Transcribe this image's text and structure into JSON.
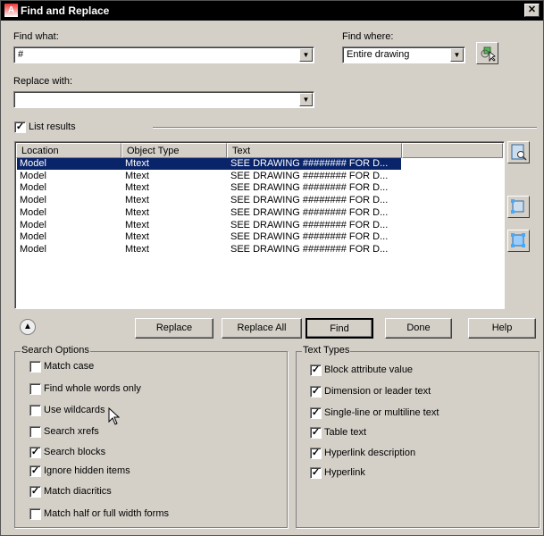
{
  "title": "Find and Replace",
  "find_what": {
    "label": "Find what:",
    "value": "#"
  },
  "find_where": {
    "label": "Find where:",
    "value": "Entire drawing"
  },
  "replace_with": {
    "label": "Replace with:",
    "value": ""
  },
  "list_results": {
    "label": "List results",
    "checked": true
  },
  "results": {
    "columns": [
      "Location",
      "Object Type",
      "Text"
    ],
    "rows": [
      [
        "Model",
        "Mtext",
        "SEE DRAWING ######## FOR D..."
      ],
      [
        "Model",
        "Mtext",
        "SEE DRAWING ######## FOR D..."
      ],
      [
        "Model",
        "Mtext",
        "SEE DRAWING ######## FOR D..."
      ],
      [
        "Model",
        "Mtext",
        "SEE DRAWING ######## FOR D..."
      ],
      [
        "Model",
        "Mtext",
        "SEE DRAWING ######## FOR D..."
      ],
      [
        "Model",
        "Mtext",
        "SEE DRAWING ######## FOR D..."
      ],
      [
        "Model",
        "Mtext",
        "SEE DRAWING ######## FOR D..."
      ],
      [
        "Model",
        "Mtext",
        "SEE DRAWING ######## FOR D..."
      ]
    ]
  },
  "buttons": {
    "replace": "Replace",
    "replace_all": "Replace All",
    "find": "Find",
    "done": "Done",
    "help": "Help"
  },
  "search_options": {
    "title": "Search Options",
    "items": [
      {
        "label": "Match case",
        "checked": false
      },
      {
        "label": "Find whole words only",
        "checked": false
      },
      {
        "label": "Use wildcards",
        "checked": false
      },
      {
        "label": "Search xrefs",
        "checked": false
      },
      {
        "label": "Search blocks",
        "checked": true
      },
      {
        "label": "Ignore hidden items",
        "checked": true
      },
      {
        "label": "Match diacritics",
        "checked": true
      },
      {
        "label": "Match half or full width forms",
        "checked": false
      }
    ]
  },
  "text_types": {
    "title": "Text Types",
    "items": [
      {
        "label": "Block attribute value",
        "checked": true
      },
      {
        "label": "Dimension or leader text",
        "checked": true
      },
      {
        "label": "Single-line or multiline text",
        "checked": true
      },
      {
        "label": "Table text",
        "checked": true
      },
      {
        "label": "Hyperlink description",
        "checked": true
      },
      {
        "label": "Hyperlink",
        "checked": true
      }
    ]
  }
}
